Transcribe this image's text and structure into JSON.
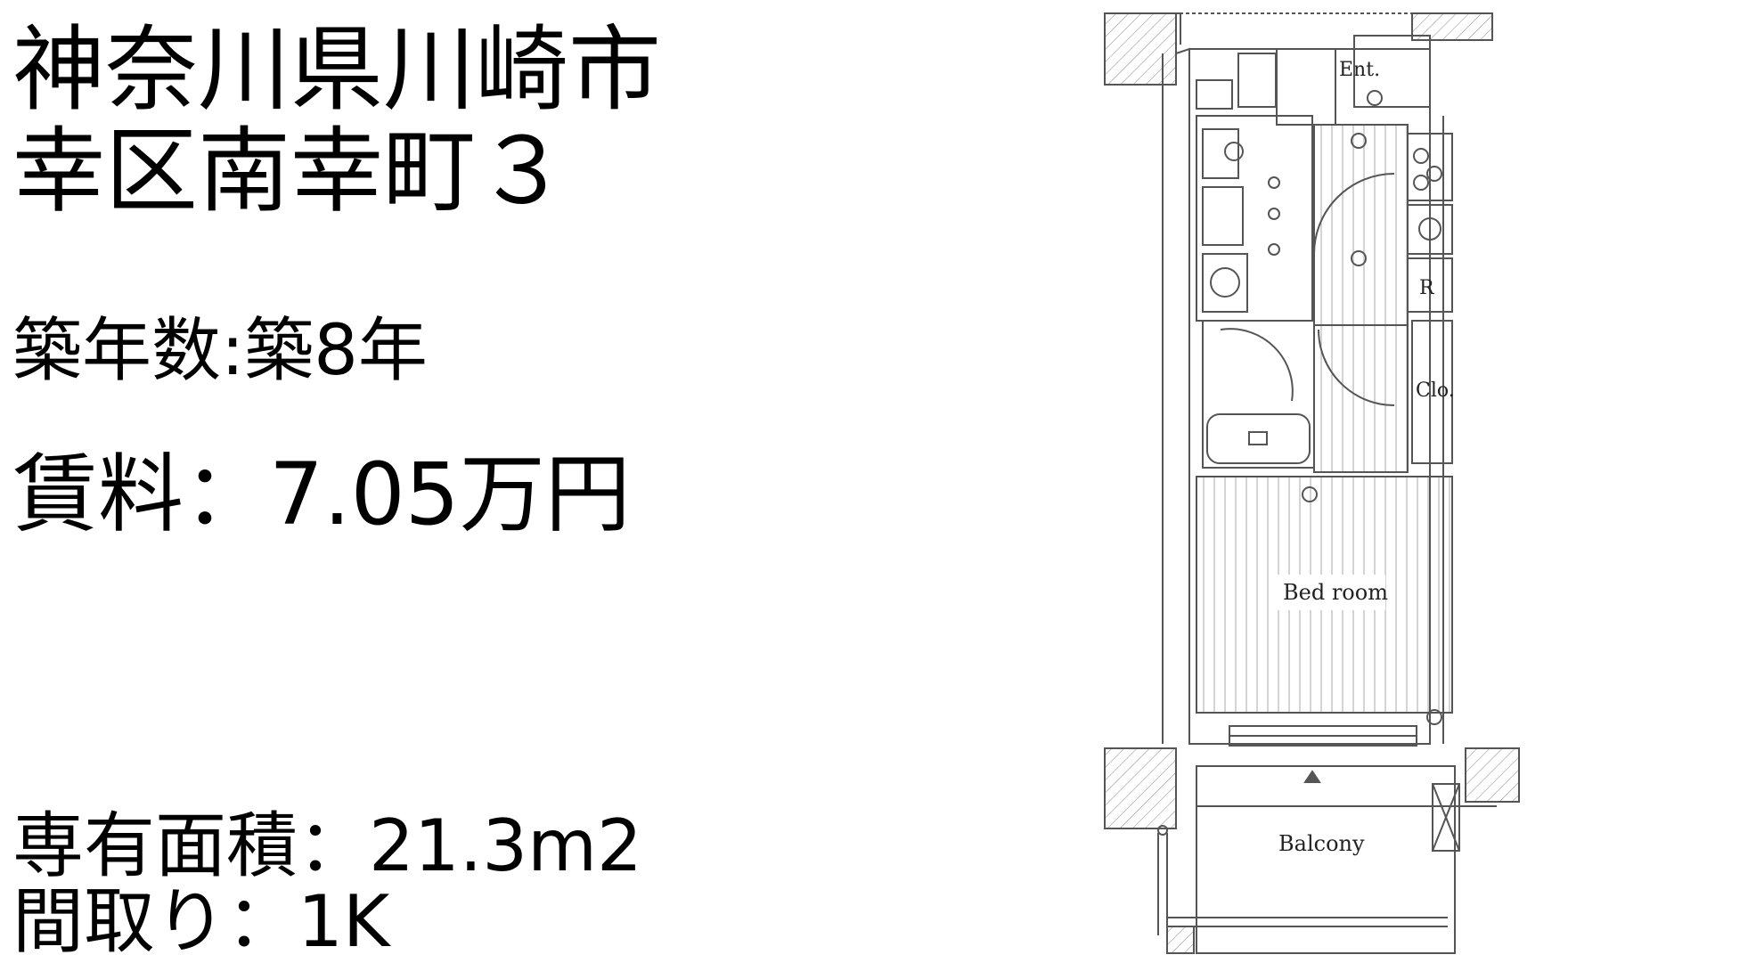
{
  "listing": {
    "address_line1": "神奈川県川崎市",
    "address_line2": "幸区南幸町３",
    "building_age": "築年数:築8年",
    "rent": "賃料：7.05万円",
    "floor_area": "専有面積：21.3m2",
    "layout": "間取り：1K"
  },
  "floorplan": {
    "labels": {
      "entrance": "Ent.",
      "refrigerator": "R",
      "closet": "Clo.",
      "bedroom": "Bed room",
      "balcony": "Balcony"
    },
    "line_color": "#555555",
    "hatch_color": "#aaaaaa"
  }
}
